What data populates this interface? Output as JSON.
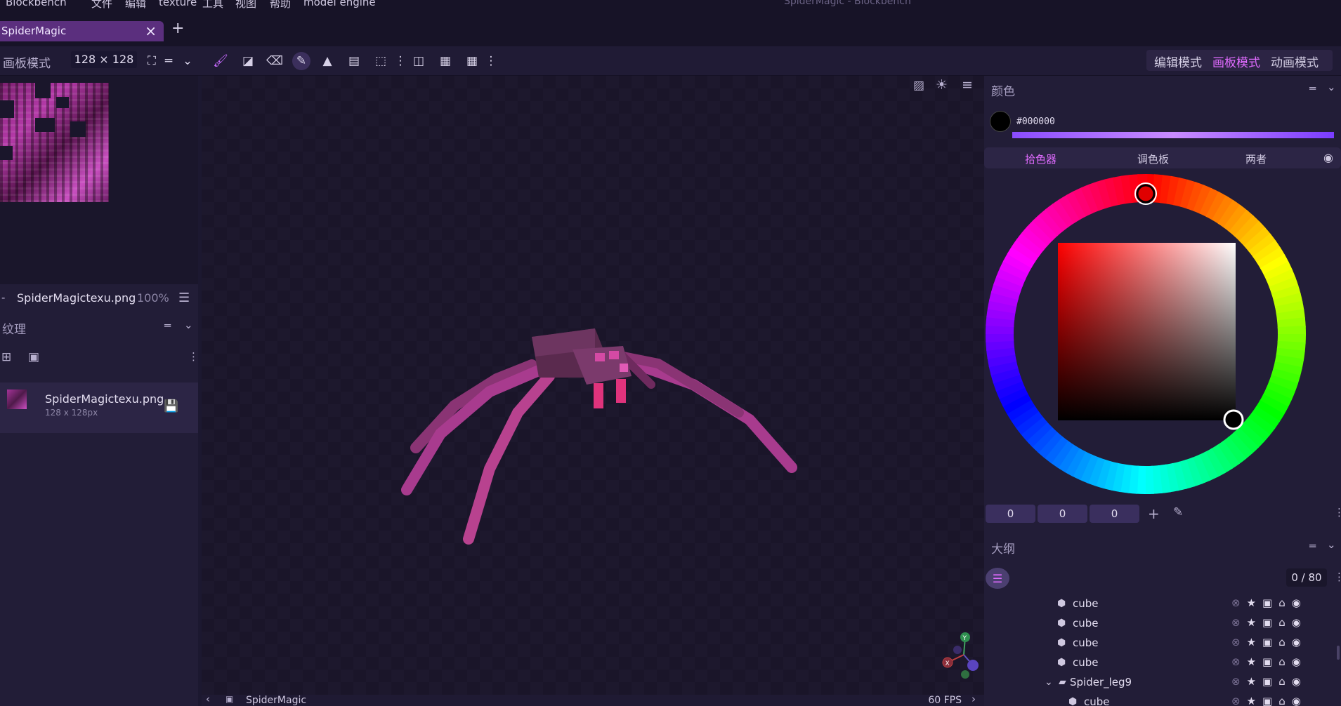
{
  "app": {
    "name": "Blockbench",
    "window_title": "SpiderMagic - Blockbench"
  },
  "menu": [
    "文件",
    "编辑",
    "texture",
    "工具",
    "视图",
    "帮助",
    "model engine"
  ],
  "tabs": [
    {
      "label": "SpiderMagic",
      "active": true
    }
  ],
  "toolbar": {
    "mode_label": "画板模式",
    "resolution": "128 × 128",
    "modes": [
      {
        "label": "编辑模式",
        "active": false
      },
      {
        "label": "画板模式",
        "active": true
      },
      {
        "label": "动画模式",
        "active": false
      }
    ],
    "tools": [
      "brush-icon",
      "fill-bucket-icon",
      "eraser-icon",
      "color-picker-icon",
      "shapes-icon",
      "gradient-icon",
      "transform-icon",
      "more-icon",
      "mirror-icon",
      "checkerboard-icon",
      "grid-icon",
      "more-icon"
    ],
    "active_tool": "color-picker-icon"
  },
  "uv_panel": {
    "file_name": "SpiderMagictexu.png",
    "zoom": "100%"
  },
  "textures_panel": {
    "title": "纹理",
    "items": [
      {
        "name": "SpiderMagictexu.png",
        "size": "128 x 128px"
      }
    ]
  },
  "viewport": {
    "name": "SpiderMagic",
    "fps": "60 FPS"
  },
  "color_panel": {
    "title": "颜色",
    "hex": "#000000",
    "tabs": [
      {
        "label": "拾色器",
        "active": true
      },
      {
        "label": "调色板",
        "active": false
      },
      {
        "label": "两者",
        "active": false
      }
    ],
    "hue_color": "#ff0000",
    "rgb": [
      "0",
      "0",
      "0"
    ]
  },
  "outliner": {
    "title": "大纲",
    "count": "0 / 80",
    "rows": [
      {
        "label": "cube",
        "type": "cube",
        "indent": 2
      },
      {
        "label": "cube",
        "type": "cube",
        "indent": 2
      },
      {
        "label": "cube",
        "type": "cube",
        "indent": 2
      },
      {
        "label": "cube",
        "type": "cube",
        "indent": 2
      },
      {
        "label": "Spider_leg9",
        "type": "group",
        "indent": 1
      },
      {
        "label": "cube",
        "type": "cube",
        "indent": 3
      }
    ]
  },
  "colors": {
    "accent": "#e06bff",
    "bg": "#1c1830",
    "panel": "#221d37"
  }
}
